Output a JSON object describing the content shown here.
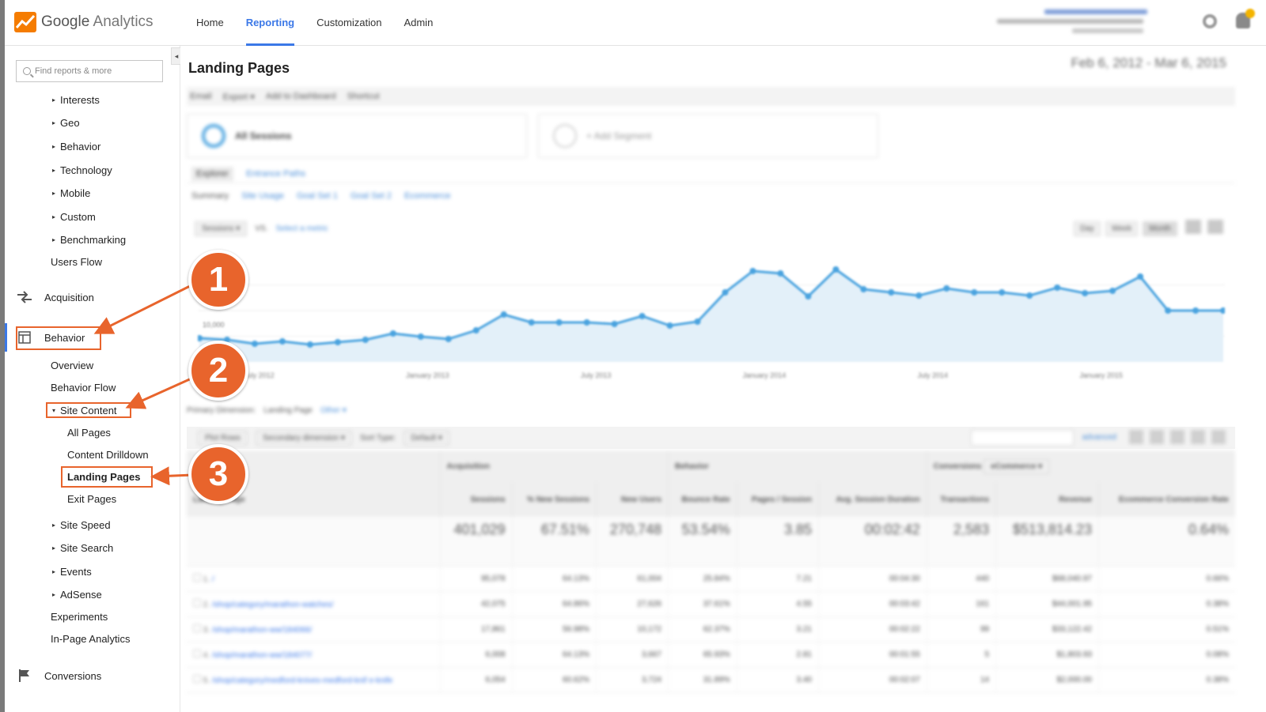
{
  "app": {
    "brand_word": "Google",
    "product_word": "Analytics",
    "nav": [
      "Home",
      "Reporting",
      "Customization",
      "Admin"
    ],
    "active_nav_index": 1
  },
  "sidebar": {
    "search_placeholder": "Find reports & more",
    "collapse_glyph": "◂",
    "audience_items": [
      "Interests",
      "Geo",
      "Behavior",
      "Technology",
      "Mobile",
      "Custom",
      "Benchmarking"
    ],
    "users_flow": "Users Flow",
    "acquisition": "Acquisition",
    "behavior": "Behavior",
    "behavior_children": {
      "overview": "Overview",
      "behavior_flow": "Behavior Flow",
      "site_content": "Site Content",
      "site_content_children": [
        "All Pages",
        "Content Drilldown",
        "Landing Pages",
        "Exit Pages"
      ],
      "rest": [
        "Site Speed",
        "Site Search",
        "Events",
        "AdSense"
      ],
      "experiments": "Experiments",
      "in_page": "In-Page Analytics"
    },
    "conversions": "Conversions"
  },
  "main": {
    "page_title": "Landing Pages",
    "date_range": "Feb 6, 2012 - Mar 6, 2015",
    "toolbar": [
      "Email",
      "Export ▾",
      "Add to Dashboard",
      "Shortcut"
    ],
    "segments": [
      "All Sessions",
      "+ Add Segment"
    ],
    "explorer_tabs": [
      "Explorer",
      "Entrance Paths"
    ],
    "subtabs": [
      "Summary",
      "Site Usage",
      "Goal Set 1",
      "Goal Set 2",
      "Ecommerce"
    ],
    "metric_dropdown": "Sessions ▾",
    "metric_vs": "VS.",
    "metric_select": "Select a metric",
    "interval": [
      "Day",
      "Week",
      "Month"
    ],
    "x_ticks": [
      "July 2012",
      "January 2013",
      "July 2013",
      "January 2014",
      "July 2014",
      "January 2015"
    ],
    "primary_dimension": "Primary Dimension:",
    "primary_value": "Landing Page",
    "other": "Other ▾",
    "plot_rows": "Plot Rows",
    "secondary_dimension": "Secondary dimension ▾",
    "sort_type": "Sort Type:",
    "sort_default": "Default ▾",
    "advanced": "advanced",
    "group_acquisition": "Acquisition",
    "group_behavior": "Behavior",
    "group_conversions": "Conversions",
    "conversions_dd": "eCommerce ▾",
    "columns": [
      "Landing Page",
      "Sessions",
      "% New Sessions",
      "New Users",
      "Bounce Rate",
      "Pages / Session",
      "Avg. Session Duration",
      "Transactions",
      "Revenue",
      "Ecommerce Conversion Rate"
    ],
    "totals": [
      "401,029",
      "67.51%",
      "270,748",
      "53.54%",
      "3.85",
      "00:02:42",
      "2,583",
      "$513,814.23",
      "0.64%"
    ],
    "rows": [
      {
        "n": "1.",
        "page": "/",
        "vals": [
          "95,078",
          "64.13%",
          "61,004",
          "25.84%",
          "7.21",
          "00:04:30",
          "440",
          "$68,040.97",
          "0.66%"
        ]
      },
      {
        "n": "2.",
        "page": "/shop/category/marathon-watches/",
        "vals": [
          "42,075",
          "64.86%",
          "27,626",
          "37.61%",
          "4.55",
          "00:03:42",
          "161",
          "$44,001.95",
          "0.38%"
        ]
      },
      {
        "n": "3.",
        "page": "/shop/marathon-ww/184066/",
        "vals": [
          "17,861",
          "56.98%",
          "10,172",
          "62.37%",
          "3.21",
          "00:02:22",
          "99",
          "$33,122.42",
          "0.51%"
        ]
      },
      {
        "n": "4.",
        "page": "/shop/marathon-ww/184077/",
        "vals": [
          "6,008",
          "64.13%",
          "3,667",
          "65.93%",
          "2.81",
          "00:01:55",
          "5",
          "$1,803.93",
          "0.08%"
        ]
      },
      {
        "n": "5.",
        "page": "/shop/category/medford-knives-medford-knif e-knife",
        "vals": [
          "6,054",
          "60.62%",
          "3,724",
          "31.89%",
          "3.40",
          "00:02:07",
          "14",
          "$2,000.00",
          "0.38%"
        ]
      }
    ]
  },
  "chart_data": {
    "type": "area",
    "x": [
      "2012-02",
      "2012-03",
      "2012-04",
      "2012-05",
      "2012-06",
      "2012-07",
      "2012-08",
      "2012-09",
      "2012-10",
      "2012-11",
      "2012-12",
      "2013-01",
      "2013-02",
      "2013-03",
      "2013-04",
      "2013-05",
      "2013-06",
      "2013-07",
      "2013-08",
      "2013-09",
      "2013-10",
      "2013-11",
      "2013-12",
      "2014-01",
      "2014-02",
      "2014-03",
      "2014-04",
      "2014-05",
      "2014-06",
      "2014-07",
      "2014-08",
      "2014-09",
      "2014-10",
      "2014-11",
      "2014-12",
      "2015-01",
      "2015-02",
      "2015-03"
    ],
    "series": [
      {
        "values": [
          9000,
          8800,
          8300,
          8600,
          8200,
          8500,
          8800,
          9600,
          9200,
          8900,
          10000,
          12000,
          11000,
          11000,
          11000,
          10800,
          11800,
          10600,
          11100,
          14800,
          17500,
          17200,
          14300,
          17700,
          15200,
          14800,
          14400,
          15300,
          14800,
          14800,
          14400,
          15400,
          14700,
          15000,
          16800,
          12500,
          12500,
          12500
        ]
      }
    ],
    "ylabel_tick": "10,000",
    "grid": true,
    "color": "#4aa3df"
  },
  "annotations": {
    "badges": [
      "1",
      "2",
      "3"
    ],
    "color": "#e8642c"
  }
}
